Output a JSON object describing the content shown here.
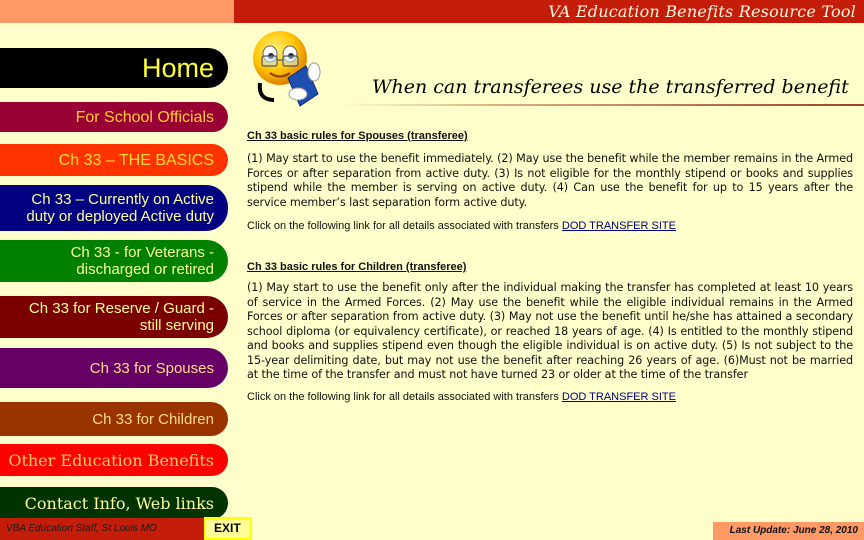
{
  "header": {
    "app_title": "VA Education Benefits Resource Tool"
  },
  "colors": {
    "topbar": "#C41E0A",
    "topbar_left": "#FF9966",
    "background": "#FFFFCC",
    "link": "#000080"
  },
  "nav": {
    "items": [
      {
        "label_lines": [
          "Home"
        ],
        "color": "#000000"
      },
      {
        "label_lines": [
          "For School Officials"
        ],
        "color": "#990033"
      },
      {
        "label_lines": [
          "Ch 33 – THE BASICS"
        ],
        "color": "#FF3300"
      },
      {
        "label_lines": [
          "Ch 33 – Currently on Active",
          "duty or deployed Active duty"
        ],
        "color": "#000080"
      },
      {
        "label_lines": [
          "Ch 33 - for Veterans -",
          "discharged or retired"
        ],
        "color": "#008000"
      },
      {
        "label_lines": [
          "Ch 33 for Reserve / Guard -",
          "still serving"
        ],
        "color": "#7A0000"
      },
      {
        "label_lines": [
          "Ch 33 for Spouses"
        ],
        "color": "#660066"
      },
      {
        "label_lines": [
          "Ch 33 for Children"
        ],
        "color": "#993300"
      },
      {
        "label_lines": [
          "Other Education Benefits"
        ],
        "color": "#FF0000"
      },
      {
        "label_lines": [
          "Contact Info, Web links"
        ],
        "color": "#003300"
      }
    ]
  },
  "mascot": {
    "icon": "reading-smiley-with-glasses-icon"
  },
  "main": {
    "title": "When can transferees use the transferred benefit",
    "sections": [
      {
        "heading": "Ch 33  basic rules for Spouses (transferee)",
        "body": "(1) May start to use the benefit immediately. (2) May use the benefit while the member remains in the Armed Forces or after separation from active duty. (3) Is not eligible for the monthly stipend or books and supplies stipend while the member is serving on active duty. (4) Can use the benefit for up to 15 years after the service member’s last separation form active duty.",
        "link_prefix": "Click on the following link for all details associated with transfers ",
        "link_label": "DOD TRANSFER SITE"
      },
      {
        "heading": "Ch 33  basic rules for Children (transferee)",
        "body": "(1) May start to use the benefit only after the individual making the transfer has completed at least 10 years of service in the Armed Forces. (2) May use the benefit while the eligible individual remains in the Armed Forces or after separation from active duty. (3) May not use the benefit until he/she has attained a secondary school diploma (or equivalency certificate), or reached 18 years of age. (4) Is entitled to the monthly stipend and books and supplies stipend even though the eligible individual is on active duty. (5) Is not subject to the 15-year delimiting date, but may not use the benefit after reaching 26 years of age. (6)Must not be married at the time of the transfer and must not have turned 23 or older at the time of the transfer",
        "link_prefix": "Click on the following link for all details associated with transfers ",
        "link_label": "DOD TRANSFER SITE"
      }
    ]
  },
  "footer": {
    "credit": "VBA Education Staff, St Louis MO",
    "exit_label": "EXIT",
    "last_update": "Last Update:  June 28, 2010"
  }
}
